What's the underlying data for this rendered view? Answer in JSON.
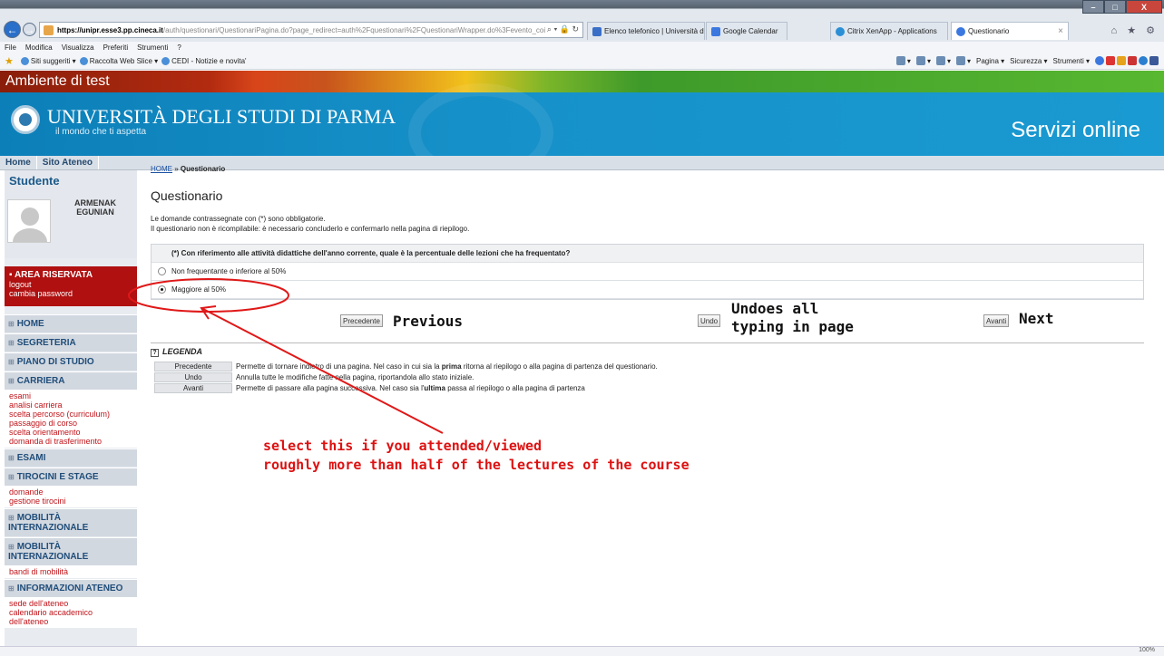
{
  "browser": {
    "url_host": "https://unipr.esse3.pp.cineca.it",
    "url_rest": "/auth/questionari/QuestionariPagina.do?page_redirect=auth%2Fquestionari%2FQuestionariWrapper.do%3Fevento_coi",
    "tabs": [
      {
        "label": "Elenco telefonico | Università d...",
        "color": "#3a6fc7"
      },
      {
        "label": "Google Calendar",
        "color": "#3a78e0"
      },
      {
        "label": "Citrix XenApp - Applications",
        "color": "#2b8fd6"
      },
      {
        "label": "Questionario",
        "color": "#3a78e0"
      }
    ],
    "menu": [
      "File",
      "Modifica",
      "Visualizza",
      "Preferiti",
      "Strumenti",
      "?"
    ],
    "favorites": [
      "Siti suggeriti ▾",
      "Raccolta Web Slice ▾",
      "CEDI - Notizie e novita'"
    ],
    "commands": [
      "Pagina ▾",
      "Sicurezza ▾",
      "Strumenti ▾"
    ],
    "zoom": "100%"
  },
  "site": {
    "env_label": "Ambiente di test",
    "university": "UNIVERSITÀ DEGLI STUDI DI PARMA",
    "motto": "il mondo che ti aspetta",
    "services": "Servizi online",
    "topnav": [
      "Home",
      "Sito Ateneo"
    ]
  },
  "sidebar": {
    "title": "Studente",
    "name_line1": "ARMENAK",
    "name_line2": "EGUNIAN",
    "area_title": "AREA RISERVATA",
    "area_links": [
      "logout",
      "cambia password"
    ],
    "sections": [
      {
        "label": "HOME",
        "links": []
      },
      {
        "label": "SEGRETERIA",
        "links": []
      },
      {
        "label": "PIANO DI STUDIO",
        "links": []
      },
      {
        "label": "CARRIERA",
        "links": [
          "esami",
          "analisi carriera",
          "scelta percorso (curriculum)",
          "passaggio di corso",
          "scelta orientamento",
          "domanda di trasferimento"
        ]
      },
      {
        "label": "ESAMI",
        "links": []
      },
      {
        "label": "TIROCINI E STAGE",
        "links": [
          "domande",
          "gestione tirocini"
        ]
      },
      {
        "label": "MOBILITÀ INTERNAZIONALE",
        "links": []
      },
      {
        "label": "MOBILITÀ INTERNAZIONALE",
        "links": [
          "bandi di mobilità"
        ]
      },
      {
        "label": "INFORMAZIONI ATENEO",
        "links": [
          "sede dell'ateneo",
          "calendario accademico dell'ateneo"
        ]
      }
    ]
  },
  "main": {
    "breadcrumb_home": "HOME",
    "breadcrumb_sep": " » ",
    "breadcrumb_current": "Questionario",
    "title": "Questionario",
    "intro1": "Le domande contrassegnate con (*) sono obbligatorie.",
    "intro2": "Il questionario non è ricompilabile: è necessario concluderlo e confermarlo nella pagina di riepilogo.",
    "question": "(*) Con riferimento alle attività didattiche dell'anno corrente, quale è la percentuale delle lezioni che ha frequentato?",
    "options": [
      {
        "label": "Non frequentante o inferiore al 50%",
        "selected": false
      },
      {
        "label": "Maggiore al 50%",
        "selected": true
      }
    ],
    "btn_prev": "Precedente",
    "btn_undo": "Undo",
    "btn_next": "Avanti",
    "legend_title": "LEGENDA",
    "legend_icon": "?",
    "legend": [
      {
        "key": "Precedente",
        "desc_a": "Permette di tornare indietro di una pagina. Nel caso in cui sia la ",
        "desc_b": "prima",
        "desc_c": " ritorna al riepilogo o alla pagina di partenza del questionario."
      },
      {
        "key": "Undo",
        "desc_a": "Annulla tutte le modifiche fatte nella pagina, riportandola allo stato iniziale.",
        "desc_b": "",
        "desc_c": ""
      },
      {
        "key": "Avanti",
        "desc_a": "Permette di passare alla pagina successiva. Nel caso sia l'",
        "desc_b": "ultima",
        "desc_c": " passa al riepilogo o alla pagina di partenza"
      }
    ]
  },
  "annotations": {
    "prev": "Previous",
    "undo_line1": "Undoes all",
    "undo_line2": "typing in page",
    "next": "Next",
    "hint_line1": "select this if you attended/viewed",
    "hint_line2": "roughly more than half of the lectures of the course",
    "color": "#dd1111"
  }
}
